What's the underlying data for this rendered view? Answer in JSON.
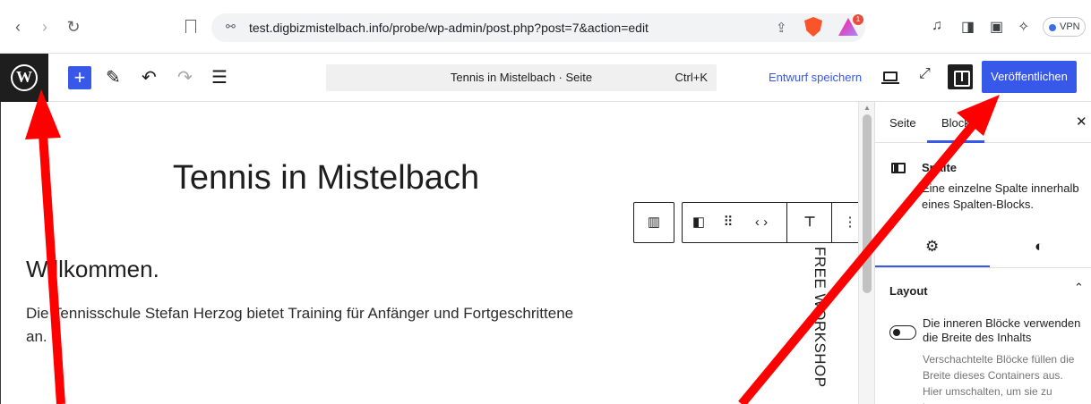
{
  "browser": {
    "back_icon": "‹",
    "forward_icon": "›",
    "reload_icon": "↻",
    "tune_icon": "⚯",
    "url": "test.digbizmistelbach.info/probe/wp-admin/post.php?post=7&action=edit",
    "share_icon": "⇪",
    "rewards_badge": "1",
    "vpn_label": "VPN",
    "media_icon": "♫",
    "sidebar_icon": "◨",
    "wallet_icon": "▣",
    "ai_icon": "✧"
  },
  "toolbar": {
    "logo": "W",
    "add_icon": "+",
    "tools_icon": "✎",
    "undo_icon": "↶",
    "redo_icon": "↷",
    "outline_icon": "☰",
    "command_title": "Tennis in Mistelbach · Seite",
    "command_shortcut": "Ctrl+K",
    "save_draft": "Entwurf speichern",
    "external_icon": "⤢",
    "publish": "Veröffentlichen"
  },
  "canvas": {
    "page_title": "Tennis in Mistelbach",
    "welcome": "Willkommen.",
    "intro": "Die Tennisschule Stefan Herzog bietet Training für Anfänger und Fortgeschrittene an.",
    "vertical_text": "FREE WORKSHOP"
  },
  "block_toolbar": {
    "parent_icon": "▥",
    "block_icon": "◧",
    "drag_icon": "⠿",
    "move_icon": "‹ ›",
    "align_icon": "⊤",
    "more_icon": "⋮"
  },
  "sidebar": {
    "tab_page": "Seite",
    "tab_block": "Block",
    "close_icon": "✕",
    "block_name": "Spalte",
    "block_description": "Eine einzelne Spalte innerhalb eines Spalten-Blocks.",
    "settings_icon": "⚙",
    "styles_icon": "◐",
    "panel_title": "Layout",
    "panel_chevron": "⌃",
    "toggle_label": "Die inneren Blöcke verwenden die Breite des Inhalts",
    "toggle_help": "Verschachtelte Blöcke füllen die Breite dieses Containers aus. Hier umschalten, um sie zu begrenzen."
  },
  "colors": {
    "accent": "#3858e9",
    "annotation": "#ff0000",
    "logo_bg": "#1e1e1e"
  }
}
